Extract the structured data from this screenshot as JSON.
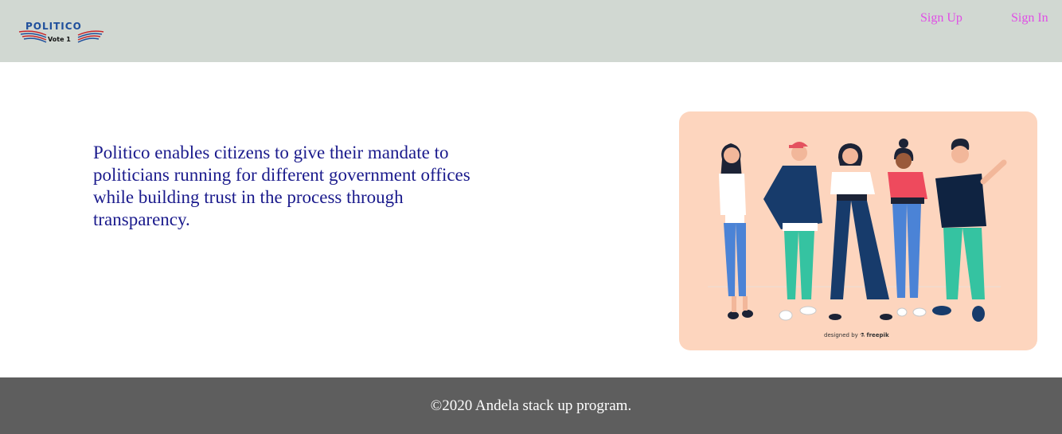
{
  "header": {
    "logo": {
      "title": "POLITICO",
      "subtitle": "Vote 1"
    },
    "nav": {
      "sign_up": "Sign Up",
      "sign_in": "Sign In"
    }
  },
  "main": {
    "tagline": "Politico enables citizens to give their mandate to politicians running for different government offices while building trust in the process through transparency.",
    "illustration": {
      "credit_prefix": "designed by",
      "credit_brand": "freepik"
    }
  },
  "footer": {
    "text": "©2020 Andela stack up program."
  },
  "colors": {
    "header_bg": "#d1d8d2",
    "nav_link": "#e04ee6",
    "tagline": "#1a1a8c",
    "hero_bg": "#fdd5be",
    "footer_bg": "#5e5e5e"
  }
}
